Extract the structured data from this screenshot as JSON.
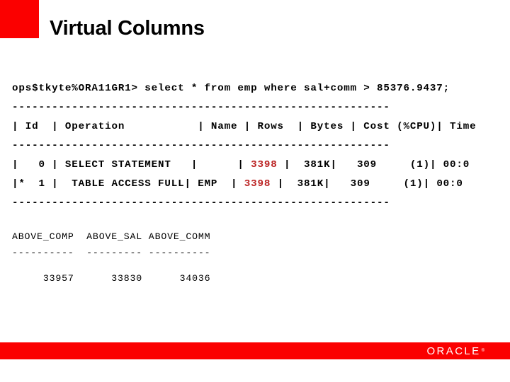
{
  "slide": {
    "title": "Virtual Columns",
    "accent_color": "#fb0000",
    "highlight_color": "#bb2222",
    "footer_brand": "ORACLE",
    "footer_trademark": "®"
  },
  "terminal": {
    "prompt_line": "ops$tkyte%ORA11GR1> select * from emp where sal+comm > 85376.9437;",
    "separator_top": "---------------------------------------------------------",
    "header_row": "| Id  | Operation           | Name | Rows  | Bytes | Cost (%CPU)| Time",
    "separator_mid": "---------------------------------------------------------",
    "rows": [
      {
        "prefix": "|   0 | SELECT STATEMENT   |      | ",
        "rows_value": "3398",
        "suffix": " |  381K|   309     (1)| 00:0"
      },
      {
        "prefix": "|*  1 |  TABLE ACCESS FULL| EMP  | ",
        "rows_value": "3398",
        "suffix": " |  381K|   309     (1)| 00:0"
      }
    ],
    "separator_bottom": "---------------------------------------------------------"
  },
  "result_set": {
    "header": "ABOVE_COMP  ABOVE_SAL ABOVE_COMM",
    "underline": "----------  --------- ----------",
    "values_row": "     33957      33830      34036",
    "columns": [
      "ABOVE_COMP",
      "ABOVE_SAL",
      "ABOVE_COMM"
    ],
    "values": [
      33957,
      33830,
      34036
    ]
  }
}
